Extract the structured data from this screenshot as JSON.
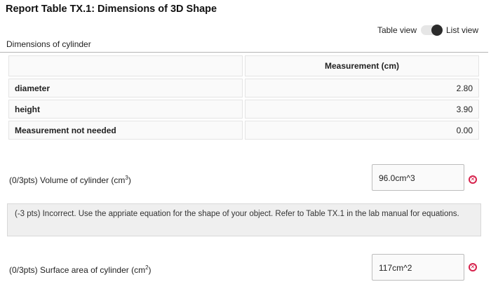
{
  "report": {
    "title": "Report Table TX.1: Dimensions of 3D Shape"
  },
  "view_toggle": {
    "left_label": "Table view",
    "right_label": "List view",
    "selected": "List view"
  },
  "table": {
    "caption": "Dimensions of cylinder",
    "columns": [
      "",
      "Measurement (cm)"
    ],
    "rows": [
      {
        "label": "diameter",
        "value": "2.80"
      },
      {
        "label": "height",
        "value": "3.90"
      },
      {
        "label": "Measurement not needed",
        "value": "0.00"
      }
    ]
  },
  "questions": [
    {
      "points": "(0/3pts)",
      "label": "Volume of cylinder (cm",
      "unit_sup": "3",
      "label_end": ")",
      "answer": "96.0cm^3",
      "status": "incorrect"
    },
    {
      "points": "(0/3pts)",
      "label": "Surface area of cylinder (cm",
      "unit_sup": "2",
      "label_end": ")",
      "answer": "117cm^2",
      "status": "incorrect"
    }
  ],
  "feedback": {
    "text": "(-3 pts) Incorrect. Use the appriate equation for the shape of your object. Refer to Table TX.1 in the lab manual for equations."
  },
  "colors": {
    "incorrect_icon": "#d6204b",
    "feedback_bg": "#efefef"
  },
  "icons": {
    "incorrect": "circle-x-icon"
  }
}
